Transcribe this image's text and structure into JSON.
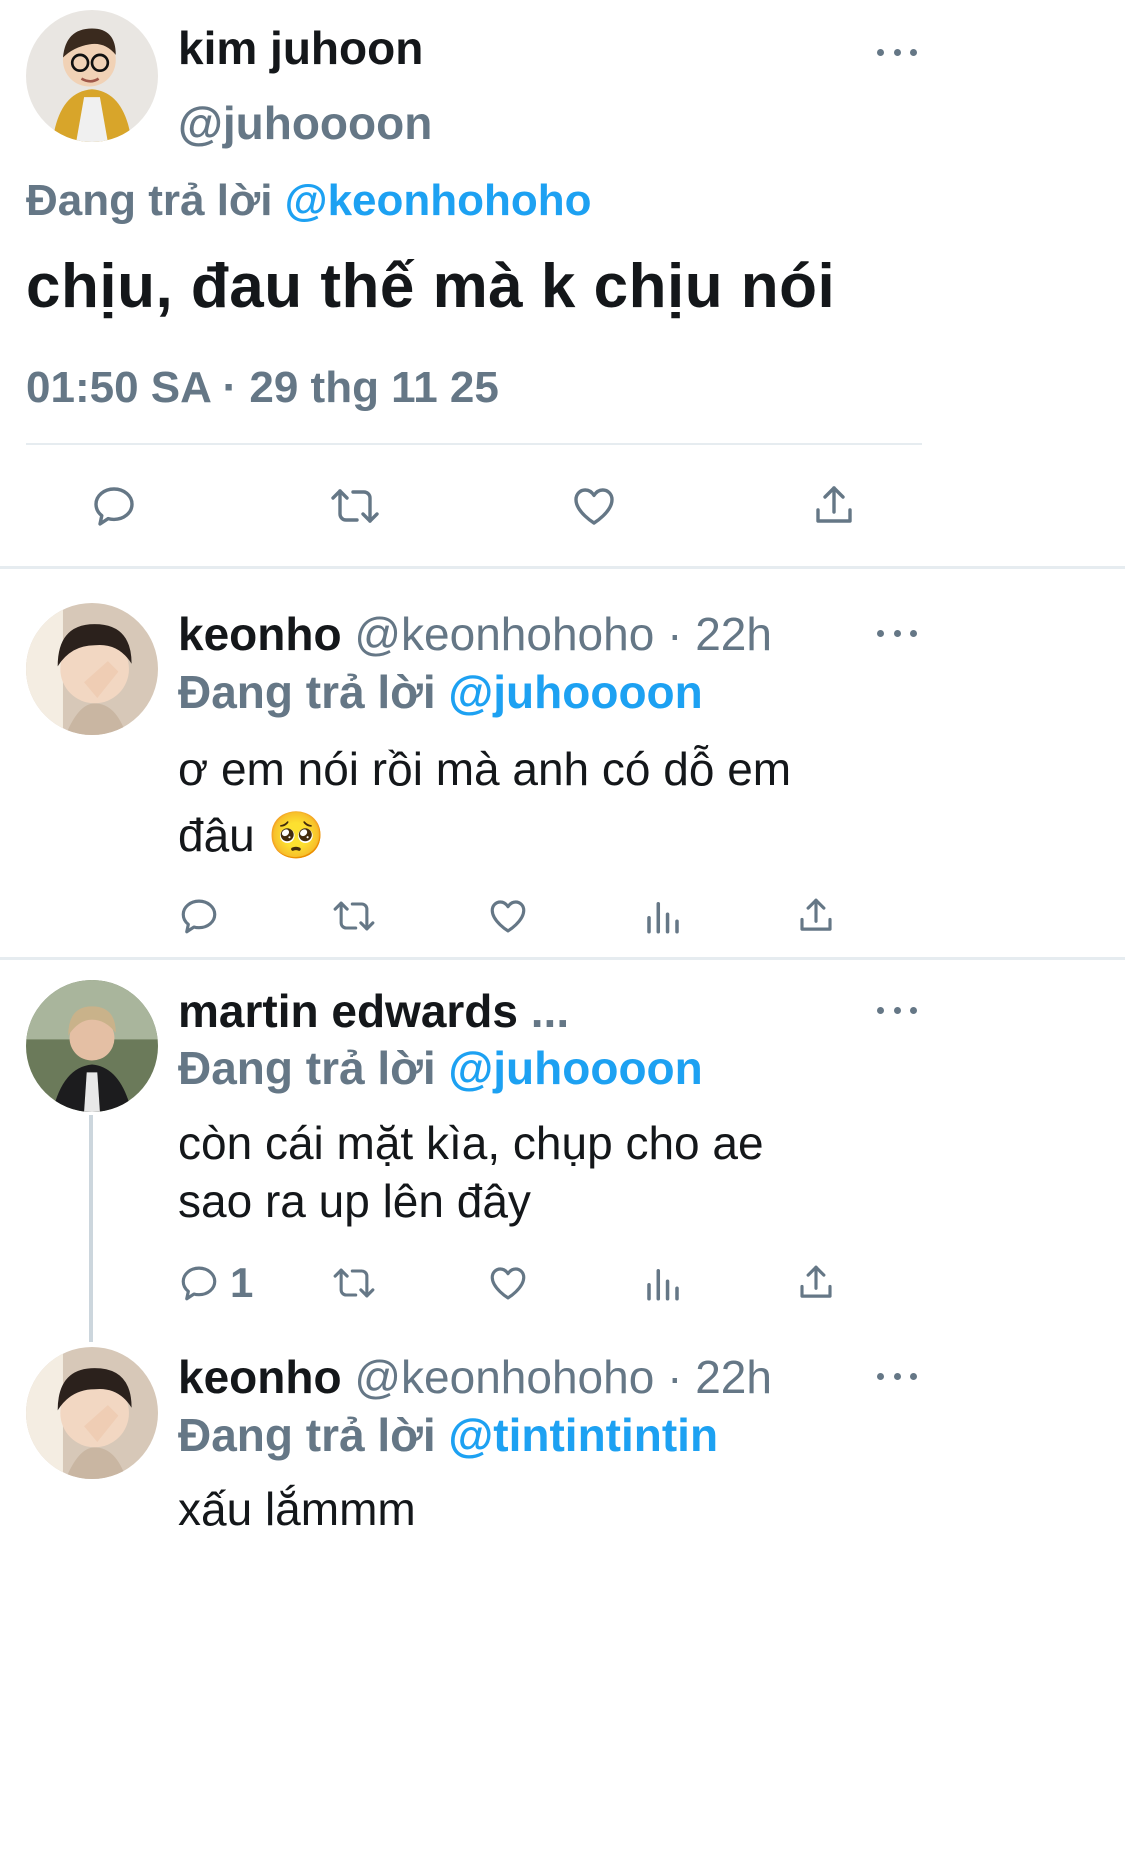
{
  "main_tweet": {
    "name": "kim juhoon",
    "handle": "@juhoooon",
    "replying_prefix": "Đang trả lời",
    "replying_to": "@keonhohoho",
    "text": "chịu, đau thế mà k chịu nói",
    "time": "01:50 SA",
    "separator": "·",
    "date": "29 thg 11 25"
  },
  "replies": [
    {
      "name": "keonho",
      "handle": "@keonhohoho",
      "separator": "·",
      "age": "22h",
      "replying_prefix": "Đang trả lời",
      "replying_to": "@juhoooon",
      "text": "ơ em nói rồi mà anh có dỗ em\nđâu 🥺",
      "reply_count": ""
    },
    {
      "name": "martin edwards",
      "name_ellipsis": "...",
      "replying_prefix": "Đang trả lời",
      "replying_to": "@juhoooon",
      "text": "còn cái mặt kìa, chụp cho ae\nsao ra up lên đây",
      "reply_count": "1"
    },
    {
      "name": "keonho",
      "handle": "@keonhohoho",
      "separator": "·",
      "age": "22h",
      "replying_prefix": "Đang trả lời",
      "replying_to": "@tintintintin",
      "text": "xấu lắmmm"
    }
  ],
  "colors": {
    "text": "#14171a",
    "secondary": "#657786",
    "accent": "#1da1f2",
    "divider": "#e6ecf0"
  },
  "icons": [
    "reply-icon",
    "retweet-icon",
    "like-icon",
    "analytics-icon",
    "share-icon",
    "more-icon"
  ]
}
